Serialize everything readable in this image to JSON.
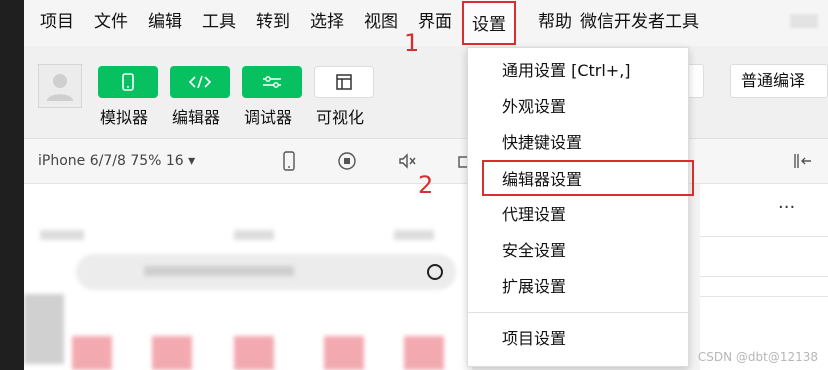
{
  "menubar": {
    "items": [
      "项目",
      "文件",
      "编辑",
      "工具",
      "转到",
      "选择",
      "视图",
      "界面",
      "设置",
      "帮助",
      "微信开发者工具"
    ]
  },
  "toolbar": {
    "buttons": [
      "模拟器",
      "编辑器",
      "调试器",
      "可视化"
    ],
    "compile_label": "普通编译"
  },
  "devbar": {
    "device_label": "iPhone 6/7/8 75% 16 ▾"
  },
  "dropdown": {
    "items": [
      "通用设置 [Ctrl+,]",
      "外观设置",
      "快捷键设置",
      "编辑器设置",
      "代理设置",
      "安全设置",
      "扩展设置",
      "项目设置"
    ]
  },
  "annotations": {
    "one": "1",
    "two": "2"
  },
  "right_panel": {
    "more": "···"
  },
  "watermark": "CSDN @dbt@12138",
  "colors": {
    "accent_green": "#07c160",
    "annotation_red": "#d72f2f"
  }
}
